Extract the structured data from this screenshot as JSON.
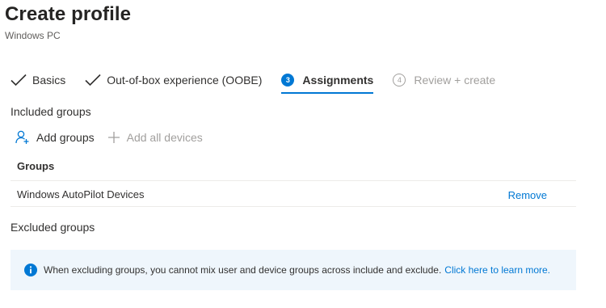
{
  "page": {
    "title": "Create profile",
    "subtitle": "Windows PC"
  },
  "tabs": [
    {
      "label": "Basics",
      "state": "completed"
    },
    {
      "label": "Out-of-box experience (OOBE)",
      "state": "completed"
    },
    {
      "label": "Assignments",
      "number": "3",
      "state": "active"
    },
    {
      "label": "Review + create",
      "number": "4",
      "state": "disabled"
    }
  ],
  "included": {
    "heading": "Included groups",
    "add_groups_label": "Add groups",
    "add_all_devices_label": "Add all devices",
    "column_header": "Groups",
    "rows": [
      {
        "name": "Windows AutoPilot Devices",
        "action": "Remove"
      }
    ]
  },
  "excluded": {
    "heading": "Excluded groups"
  },
  "info": {
    "message": "When excluding groups, you cannot mix user and device groups across include and exclude.",
    "link_text": "Click here to learn more."
  },
  "colors": {
    "accent": "#0078d4",
    "info_bg": "#eff6fc",
    "disabled": "#a19f9d"
  }
}
